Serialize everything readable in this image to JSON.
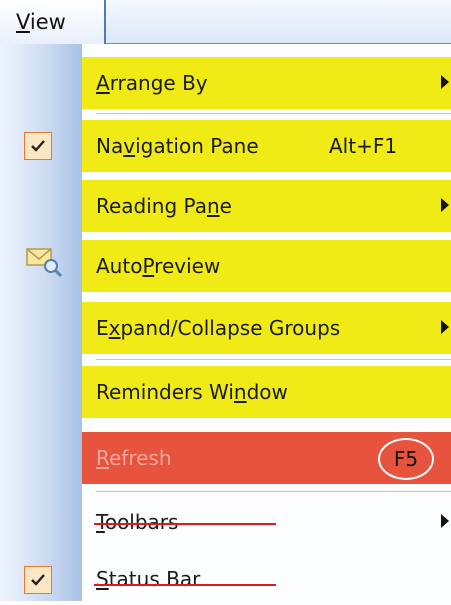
{
  "menubar": {
    "view_label": "View"
  },
  "items": [
    {
      "label_pre": "",
      "label_ul": "A",
      "label_post": "rrange By",
      "shortcut": "",
      "submenu": true
    },
    {
      "label_pre": "Na",
      "label_ul": "v",
      "label_post": "igation Pane",
      "shortcut": "Alt+F1",
      "submenu": false,
      "checked": true
    },
    {
      "label_pre": "Reading Pa",
      "label_ul": "n",
      "label_post": "e",
      "shortcut": "",
      "submenu": true
    },
    {
      "label_pre": "Auto",
      "label_ul": "P",
      "label_post": "review",
      "shortcut": "",
      "submenu": false,
      "icon": "mail-preview-icon"
    },
    {
      "label_pre": "E",
      "label_ul": "x",
      "label_post": "pand/Collapse Groups",
      "shortcut": "",
      "submenu": true
    },
    {
      "label_pre": "Reminders Wi",
      "label_ul": "n",
      "label_post": "dow",
      "shortcut": "",
      "submenu": false
    },
    {
      "label_pre": "",
      "label_ul": "R",
      "label_post": "efresh",
      "shortcut": "F5",
      "submenu": false,
      "disabled": true
    },
    {
      "label_pre": "",
      "label_ul": "T",
      "label_post": "oolbars",
      "shortcut": "",
      "submenu": true
    },
    {
      "label_pre": "",
      "label_ul": "S",
      "label_post": "tatus Bar",
      "shortcut": "",
      "submenu": false,
      "checked": true
    }
  ],
  "colors": {
    "highlight": "#f0ea15",
    "refresh_bg": "#e8533e",
    "strike": "#e0191f",
    "check_border": "#e6792f"
  }
}
